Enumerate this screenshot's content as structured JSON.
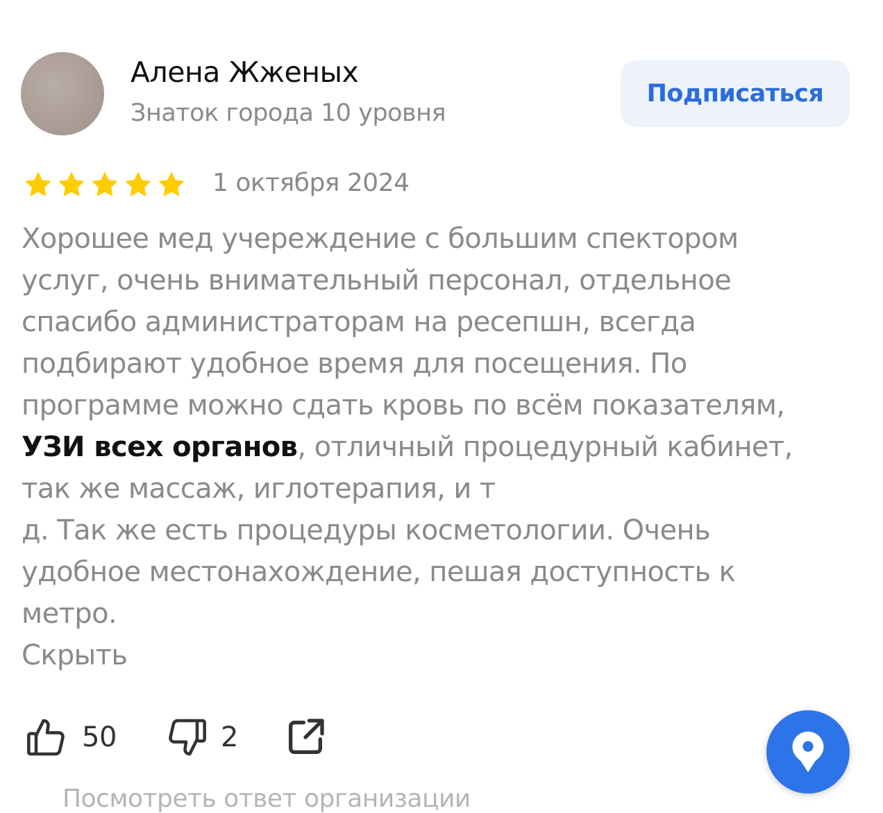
{
  "author": {
    "name": "Алена Жженых",
    "level": "Знаток города 10 уровня"
  },
  "subscribe_label": "Подписаться",
  "review": {
    "rating": 5,
    "rating_max": 5,
    "date": "1 октября 2024",
    "lines": {
      "l1": "Хорошее мед учереждение с большим спектором",
      "l2": "услуг, очень внимательный персонал, отдельное",
      "l3": "спасибо администраторам на ресепшн, всегда",
      "l4": "подбирают удобное время для посещения. По",
      "l5": "программе можно сдать кровь по всём показателям,",
      "l6_highlight": "УЗИ всех органов",
      "l6_rest": ", отличный процедурный кабинет,",
      "l7": "так же массаж, иглотерапия, и т",
      "l8": "д. Так же есть процедуры косметологии. Очень",
      "l9": "удобное местонахождение, пешая доступность к",
      "l10": "метро."
    },
    "hide_label": "Скрыть"
  },
  "reactions": {
    "likes": "50",
    "dislikes": "2"
  },
  "org_reply_label": "Посмотреть ответ организации",
  "icons": {
    "like": "thumbs-up-icon",
    "dislike": "thumbs-down-icon",
    "share": "share-icon",
    "fab": "map-pin-icon"
  },
  "colors": {
    "star": "#ffcc00",
    "accent": "#2a6ddc",
    "fab": "#2d74e8",
    "muted_text": "#8a8a8a"
  }
}
